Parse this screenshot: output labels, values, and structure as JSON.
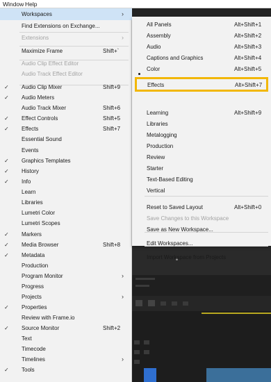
{
  "menubar": {
    "items": [
      "Window",
      "Help"
    ]
  },
  "window_menu": {
    "items": [
      {
        "label": "Workspaces",
        "shortcut": "",
        "checked": false,
        "submenu": true,
        "disabled": false,
        "highlighted": true
      },
      {
        "label": "Find Extensions on Exchange...",
        "shortcut": "",
        "checked": false,
        "submenu": false,
        "disabled": false
      },
      {
        "label": "Extensions",
        "shortcut": "",
        "checked": false,
        "submenu": true,
        "disabled": true
      },
      {
        "label": "Maximize Frame",
        "shortcut": "Shift+`",
        "checked": false,
        "submenu": false,
        "disabled": false
      },
      {
        "label": "Audio Clip Effect Editor",
        "shortcut": "",
        "checked": false,
        "submenu": false,
        "disabled": true
      },
      {
        "label": "Audio Track Effect Editor",
        "shortcut": "",
        "checked": false,
        "submenu": false,
        "disabled": true
      },
      {
        "label": "Audio Clip Mixer",
        "shortcut": "Shift+9",
        "checked": true,
        "submenu": false,
        "disabled": false
      },
      {
        "label": "Audio Meters",
        "shortcut": "",
        "checked": true,
        "submenu": false,
        "disabled": false
      },
      {
        "label": "Audio Track Mixer",
        "shortcut": "Shift+6",
        "checked": false,
        "submenu": false,
        "disabled": false
      },
      {
        "label": "Effect Controls",
        "shortcut": "Shift+5",
        "checked": true,
        "submenu": false,
        "disabled": false
      },
      {
        "label": "Effects",
        "shortcut": "Shift+7",
        "checked": true,
        "submenu": false,
        "disabled": false
      },
      {
        "label": "Essential Sound",
        "shortcut": "",
        "checked": false,
        "submenu": false,
        "disabled": false
      },
      {
        "label": "Events",
        "shortcut": "",
        "checked": false,
        "submenu": false,
        "disabled": false
      },
      {
        "label": "Graphics Templates",
        "shortcut": "",
        "checked": true,
        "submenu": false,
        "disabled": false
      },
      {
        "label": "History",
        "shortcut": "",
        "checked": true,
        "submenu": false,
        "disabled": false
      },
      {
        "label": "Info",
        "shortcut": "",
        "checked": true,
        "submenu": false,
        "disabled": false
      },
      {
        "label": "Learn",
        "shortcut": "",
        "checked": false,
        "submenu": false,
        "disabled": false
      },
      {
        "label": "Libraries",
        "shortcut": "",
        "checked": false,
        "submenu": false,
        "disabled": false
      },
      {
        "label": "Lumetri Color",
        "shortcut": "",
        "checked": false,
        "submenu": false,
        "disabled": false
      },
      {
        "label": "Lumetri Scopes",
        "shortcut": "",
        "checked": false,
        "submenu": false,
        "disabled": false
      },
      {
        "label": "Markers",
        "shortcut": "",
        "checked": true,
        "submenu": false,
        "disabled": false
      },
      {
        "label": "Media Browser",
        "shortcut": "Shift+8",
        "checked": true,
        "submenu": false,
        "disabled": false
      },
      {
        "label": "Metadata",
        "shortcut": "",
        "checked": true,
        "submenu": false,
        "disabled": false
      },
      {
        "label": "Production",
        "shortcut": "",
        "checked": false,
        "submenu": false,
        "disabled": false
      },
      {
        "label": "Program Monitor",
        "shortcut": "",
        "checked": false,
        "submenu": true,
        "disabled": false
      },
      {
        "label": "Progress",
        "shortcut": "",
        "checked": false,
        "submenu": false,
        "disabled": false
      },
      {
        "label": "Projects",
        "shortcut": "",
        "checked": false,
        "submenu": true,
        "disabled": false
      },
      {
        "label": "Properties",
        "shortcut": "",
        "checked": true,
        "submenu": false,
        "disabled": false
      },
      {
        "label": "Review with Frame.io",
        "shortcut": "",
        "checked": false,
        "submenu": false,
        "disabled": false
      },
      {
        "label": "Source Monitor",
        "shortcut": "Shift+2",
        "checked": true,
        "submenu": false,
        "disabled": false
      },
      {
        "label": "Text",
        "shortcut": "",
        "checked": false,
        "submenu": false,
        "disabled": false
      },
      {
        "label": "Timecode",
        "shortcut": "",
        "checked": false,
        "submenu": false,
        "disabled": false
      },
      {
        "label": "Timelines",
        "shortcut": "",
        "checked": false,
        "submenu": true,
        "disabled": false
      },
      {
        "label": "Tools",
        "shortcut": "",
        "checked": true,
        "submenu": false,
        "disabled": false
      }
    ]
  },
  "workspaces_submenu": {
    "items": [
      {
        "label": "All Panels",
        "shortcut": "Alt+Shift+1"
      },
      {
        "label": "Assembly",
        "shortcut": "Alt+Shift+2"
      },
      {
        "label": "Audio",
        "shortcut": "Alt+Shift+3"
      },
      {
        "label": "Captions and Graphics",
        "shortcut": "Alt+Shift+4"
      },
      {
        "label": "Color",
        "shortcut": "Alt+Shift+5"
      },
      {
        "label": "Effects",
        "shortcut": "Alt+Shift+7"
      },
      {
        "label": "Learning",
        "shortcut": "Alt+Shift+9"
      },
      {
        "label": "Libraries",
        "shortcut": ""
      },
      {
        "label": "Metalogging",
        "shortcut": ""
      },
      {
        "label": "Production",
        "shortcut": ""
      },
      {
        "label": "Review",
        "shortcut": ""
      },
      {
        "label": "Starter",
        "shortcut": ""
      },
      {
        "label": "Text-Based Editing",
        "shortcut": ""
      },
      {
        "label": "Vertical",
        "shortcut": ""
      },
      {
        "label": "Reset to Saved Layout",
        "shortcut": "Alt+Shift+0"
      },
      {
        "label": "Save Changes to this Workspace",
        "shortcut": "",
        "disabled": true
      },
      {
        "label": "Save as New Workspace...",
        "shortcut": ""
      },
      {
        "label": "Edit Workspaces...",
        "shortcut": ""
      },
      {
        "label": "Import Workspace from Projects",
        "shortcut": ""
      }
    ],
    "focused": {
      "label": "Effects",
      "shortcut": "Alt+Shift+7"
    }
  },
  "colors": {
    "focus_outline": "#f2b705",
    "menu_bg": "#f2f2f2",
    "highlight": "#cfe3f6"
  }
}
